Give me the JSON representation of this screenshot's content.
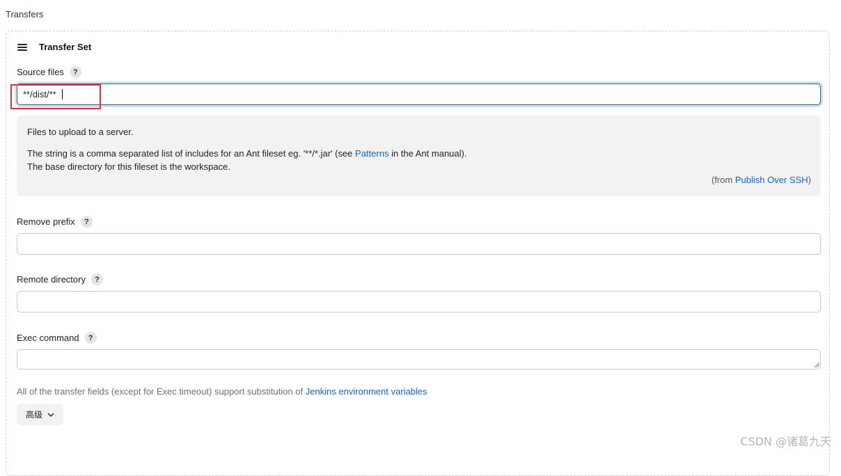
{
  "section": {
    "title": "Transfers"
  },
  "transfer_set": {
    "title": "Transfer Set",
    "source_files": {
      "label": "Source files",
      "help": "?",
      "value": "**/dist/**",
      "help_text": {
        "line1": "Files to upload to a server.",
        "line2_prefix": "The string is a comma separated list of includes for an Ant fileset eg. '**/*.jar' (see ",
        "line2_link": "Patterns",
        "line2_suffix": " in the Ant manual).",
        "line3": "The base directory for this fileset is the workspace.",
        "from_prefix": "(from ",
        "from_link": "Publish Over SSH",
        "from_suffix": ")"
      }
    },
    "remove_prefix": {
      "label": "Remove prefix",
      "help": "?",
      "value": ""
    },
    "remote_directory": {
      "label": "Remote directory",
      "help": "?",
      "value": ""
    },
    "exec_command": {
      "label": "Exec command",
      "help": "?",
      "value": ""
    },
    "note": {
      "prefix": "All of the transfer fields (except for Exec timeout) support substitution of ",
      "link": "Jenkins environment variables"
    },
    "advanced_button": {
      "label": "高级",
      "icon": "chevron-down-icon"
    }
  },
  "watermark": "CSDN @诸葛九天",
  "colors": {
    "link": "#1565c0",
    "highlight": "#e0303a",
    "focus_ring": "#cfe2f3"
  }
}
